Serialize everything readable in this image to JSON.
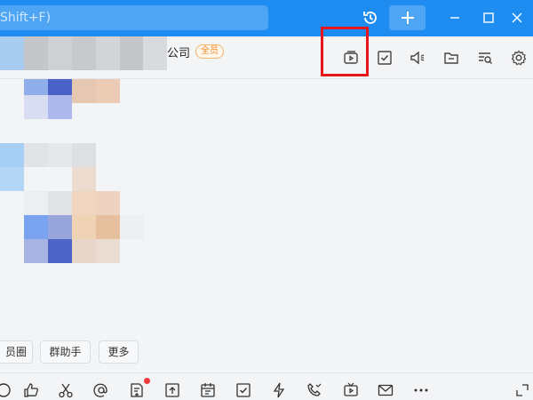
{
  "search": {
    "placeholder_visible": "Shift+F)"
  },
  "titlebar": {
    "history_icon": "history-icon",
    "plus_icon": "plus-icon",
    "minimize_icon": "minimize-icon",
    "maximize_icon": "maximize-icon",
    "close_icon": "close-icon"
  },
  "header": {
    "group_name": "公司",
    "badge": "全员",
    "icons": [
      "live-video-icon",
      "task-check-icon",
      "announcement-icon",
      "folder-icon",
      "search-history-icon",
      "settings-gear-icon"
    ]
  },
  "chips": [
    "员圈",
    "群助手",
    "更多"
  ],
  "bottom_toolbar": {
    "icons": [
      "emoji-icon",
      "thumbs-up-icon",
      "scissors-icon",
      "mention-icon",
      "new-doc-icon",
      "upload-icon",
      "calendar-icon",
      "check-task-icon",
      "lightning-icon",
      "phone-icon",
      "tv-live-icon",
      "mail-icon",
      "more-icon",
      "expand-icon"
    ]
  },
  "colors": {
    "titlebar": "#1e8cf0",
    "highlight": "#e8151b",
    "accent": "#1e8cf0"
  }
}
